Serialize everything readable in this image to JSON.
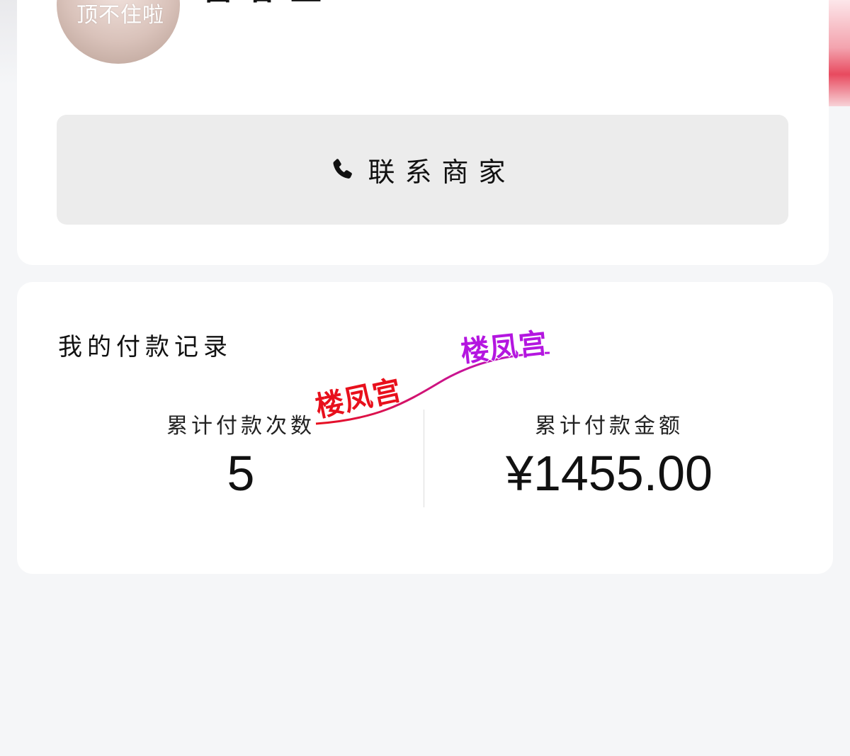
{
  "profile": {
    "avatar_caption": "顶不住啦",
    "nickname": "雷春玉"
  },
  "contact": {
    "label": "联系商家",
    "icon": "phone-icon"
  },
  "payments": {
    "title": "我的付款记录",
    "count_label": "累计付款次数",
    "count_value": "5",
    "amount_label": "累计付款金额",
    "amount_value": "¥1455.00"
  },
  "watermark": {
    "text_1": "楼凤宫",
    "text_2": "楼凤宫",
    "color_1": "#e8101c",
    "color_2": "#b416e0"
  }
}
